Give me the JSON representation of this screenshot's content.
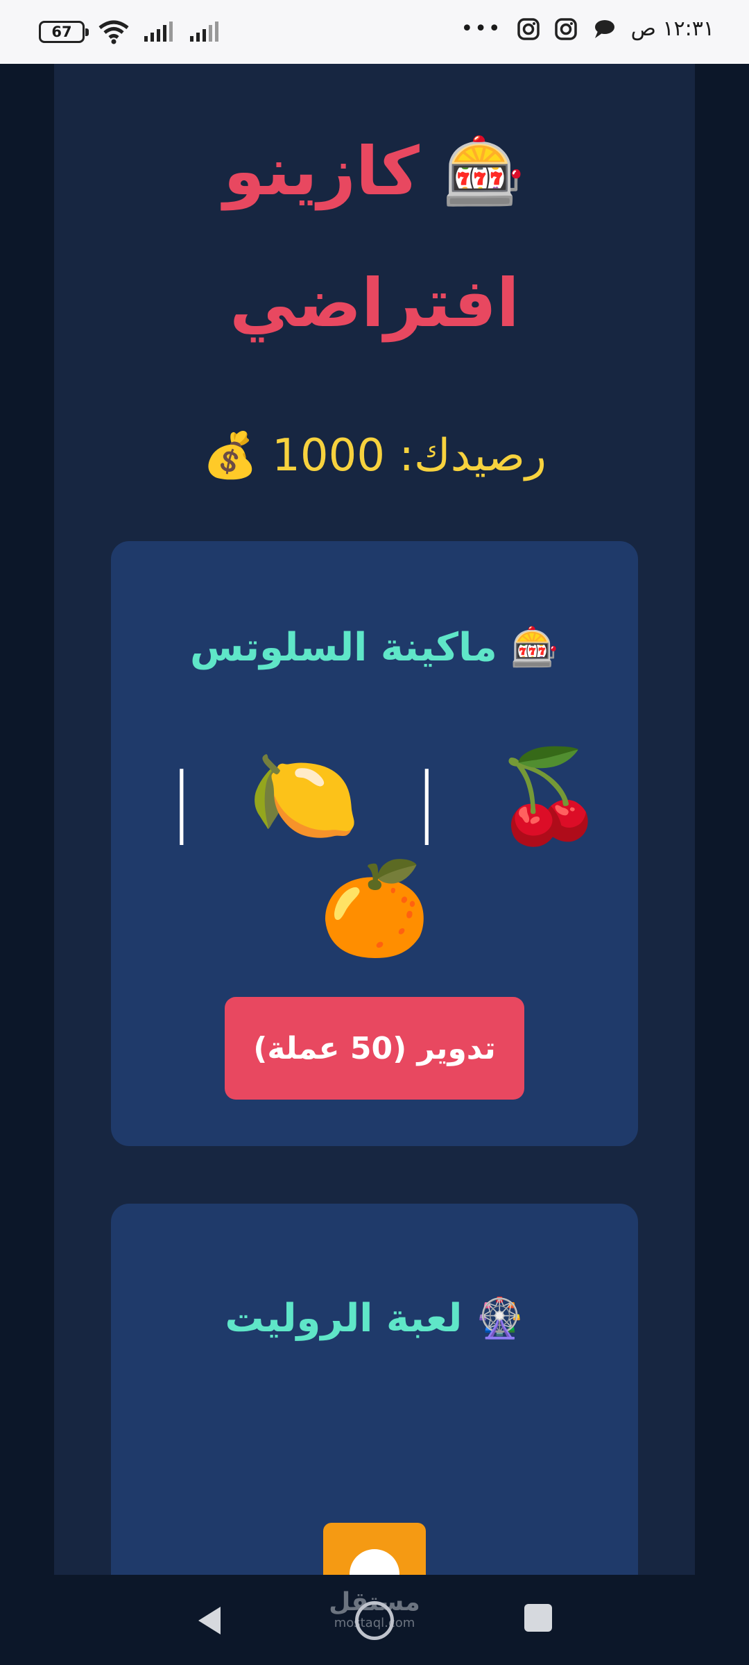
{
  "status_bar": {
    "time": "١٢:٣١ ص",
    "battery": "67",
    "overflow": "•••",
    "icons": [
      "chat-bubble-icon",
      "instagram-icon",
      "instagram-icon",
      "signal-icon",
      "signal-icon",
      "wifi-icon"
    ]
  },
  "app": {
    "title_line1": "🎰 كازينو",
    "title_line2": "افتراضي",
    "balance": "رصيدك: 1000 💰"
  },
  "slots": {
    "title": "🎰 ماكينة السلوتس",
    "reel_1": "🍒",
    "reel_2": "🍋",
    "reel_3": "🍊",
    "separator": "|",
    "spin_label": "تدوير (50 عملة)"
  },
  "roulette": {
    "title": "🎡 لعبة الروليت",
    "result_icon": "orange-square-white-circle-icon"
  },
  "nav": {
    "watermark": "مستقل",
    "watermark_sub": "mostaql.com"
  },
  "colors": {
    "title": "#e84860",
    "balance": "#f7d23e",
    "card_title": "#5fe6c8",
    "button": "#e84860",
    "card_bg": "#1f3a6a",
    "page_bg": "#172641"
  }
}
